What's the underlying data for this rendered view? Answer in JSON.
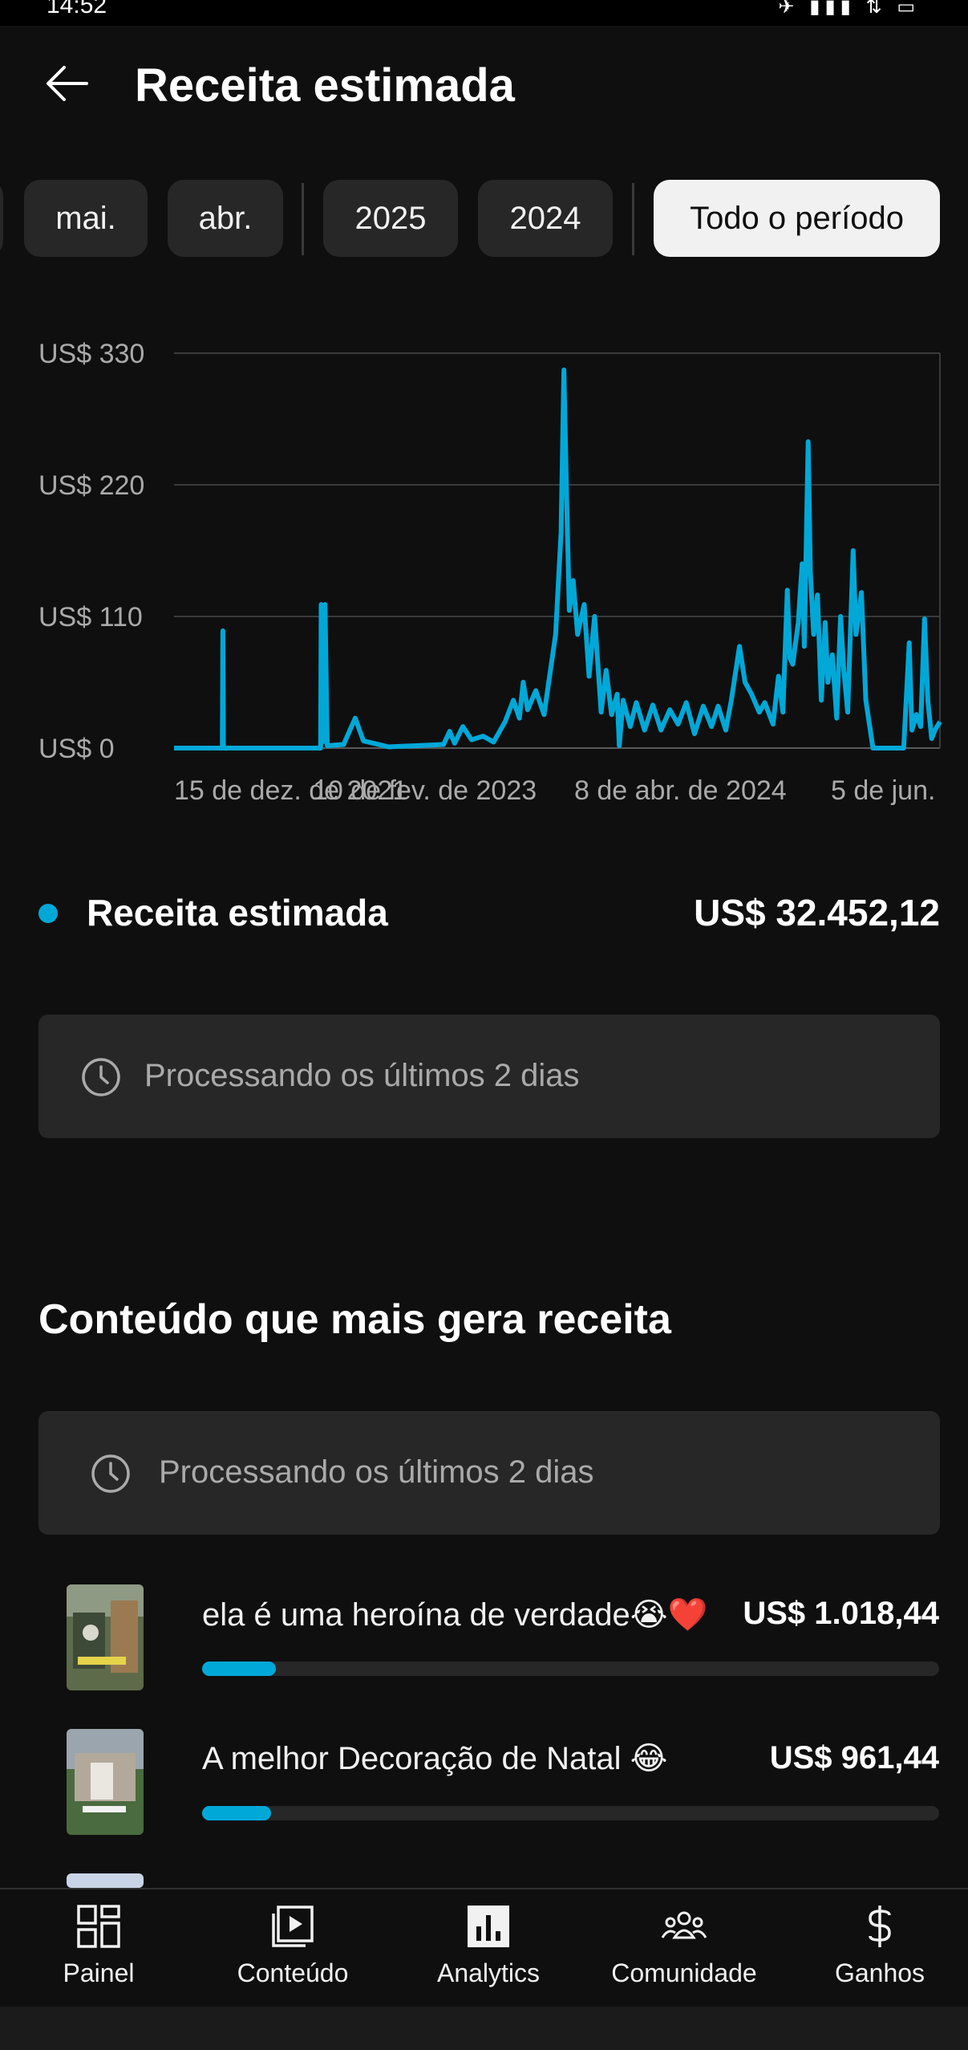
{
  "status_bar": {
    "time": "14:52",
    "icons_text": "✈ ▮▮▮ ⇅ ▭"
  },
  "header": {
    "title": "Receita estimada",
    "back_icon": "arrow-left-icon"
  },
  "filters": {
    "chips": [
      "mai.",
      "abr.",
      "2025",
      "2024",
      "Todo o período"
    ],
    "selected": "Todo o período"
  },
  "colors": {
    "accent": "#00a8d8",
    "background": "#0f0f0f",
    "card": "#272727",
    "muted_text": "#aaaaaa"
  },
  "chart_data": {
    "type": "line",
    "y_ticks": [
      "US$ 330",
      "US$ 220",
      "US$ 110",
      "US$ 0"
    ],
    "ylim": [
      0,
      330
    ],
    "x_tick_labels": [
      "15 de dez. de 2021",
      "10 de fev. de 2023",
      "8 de abr. de 2024",
      "5 de jun."
    ],
    "x_range": [
      "2021-12-15",
      "2025-06-05"
    ],
    "grid": true,
    "series": [
      {
        "name": "Receita estimada",
        "points": [
          [
            "2021-12-15",
            0
          ],
          [
            "2022-03-01",
            0
          ],
          [
            "2022-03-13",
            0
          ],
          [
            "2022-03-14",
            98
          ],
          [
            "2022-03-15",
            0
          ],
          [
            "2022-08-20",
            0
          ],
          [
            "2022-09-08",
            0
          ],
          [
            "2022-09-09",
            120
          ],
          [
            "2022-09-12",
            5
          ],
          [
            "2022-09-16",
            120
          ],
          [
            "2022-09-20",
            2
          ],
          [
            "2022-10-20",
            3
          ],
          [
            "2022-11-10",
            25
          ],
          [
            "2022-11-25",
            6
          ],
          [
            "2023-01-10",
            1
          ],
          [
            "2023-03-01",
            2
          ],
          [
            "2023-04-20",
            3
          ],
          [
            "2023-05-01",
            14
          ],
          [
            "2023-05-10",
            4
          ],
          [
            "2023-05-25",
            18
          ],
          [
            "2023-06-10",
            7
          ],
          [
            "2023-07-01",
            10
          ],
          [
            "2023-07-20",
            5
          ],
          [
            "2023-08-10",
            22
          ],
          [
            "2023-08-25",
            40
          ],
          [
            "2023-09-05",
            25
          ],
          [
            "2023-09-12",
            55
          ],
          [
            "2023-09-20",
            32
          ],
          [
            "2023-10-05",
            48
          ],
          [
            "2023-10-20",
            28
          ],
          [
            "2023-11-10",
            95
          ],
          [
            "2023-11-20",
            180
          ],
          [
            "2023-11-25",
            316
          ],
          [
            "2023-11-30",
            210
          ],
          [
            "2023-12-05",
            115
          ],
          [
            "2023-12-12",
            140
          ],
          [
            "2023-12-20",
            95
          ],
          [
            "2024-01-01",
            120
          ],
          [
            "2024-01-10",
            60
          ],
          [
            "2024-01-20",
            110
          ],
          [
            "2024-02-01",
            30
          ],
          [
            "2024-02-10",
            65
          ],
          [
            "2024-02-20",
            28
          ],
          [
            "2024-03-01",
            45
          ],
          [
            "2024-03-05",
            2
          ],
          [
            "2024-03-12",
            40
          ],
          [
            "2024-03-25",
            18
          ],
          [
            "2024-04-05",
            38
          ],
          [
            "2024-04-20",
            15
          ],
          [
            "2024-05-05",
            36
          ],
          [
            "2024-05-20",
            15
          ],
          [
            "2024-06-05",
            32
          ],
          [
            "2024-06-20",
            20
          ],
          [
            "2024-07-05",
            38
          ],
          [
            "2024-07-20",
            12
          ],
          [
            "2024-08-05",
            35
          ],
          [
            "2024-08-20",
            18
          ],
          [
            "2024-09-01",
            35
          ],
          [
            "2024-09-15",
            15
          ],
          [
            "2024-09-25",
            40
          ],
          [
            "2024-10-10",
            85
          ],
          [
            "2024-10-20",
            55
          ],
          [
            "2024-11-01",
            45
          ],
          [
            "2024-11-15",
            30
          ],
          [
            "2024-11-25",
            38
          ],
          [
            "2024-12-10",
            20
          ],
          [
            "2024-12-20",
            60
          ],
          [
            "2024-12-28",
            30
          ],
          [
            "2025-01-05",
            132
          ],
          [
            "2025-01-10",
            75
          ],
          [
            "2025-01-15",
            70
          ],
          [
            "2025-01-25",
            105
          ],
          [
            "2025-02-01",
            154
          ],
          [
            "2025-02-05",
            85
          ],
          [
            "2025-02-12",
            256
          ],
          [
            "2025-02-16",
            148
          ],
          [
            "2025-02-22",
            95
          ],
          [
            "2025-03-01",
            128
          ],
          [
            "2025-03-08",
            40
          ],
          [
            "2025-03-15",
            105
          ],
          [
            "2025-03-20",
            55
          ],
          [
            "2025-03-28",
            78
          ],
          [
            "2025-04-05",
            25
          ],
          [
            "2025-04-12",
            110
          ],
          [
            "2025-04-18",
            65
          ],
          [
            "2025-04-25",
            30
          ],
          [
            "2025-05-05",
            165
          ],
          [
            "2025-05-10",
            95
          ],
          [
            "2025-05-20",
            130
          ],
          [
            "2025-05-28",
            40
          ],
          [
            "2025-06-10",
            0
          ],
          [
            "2025-07-20",
            0
          ],
          [
            "2025-08-05",
            0
          ],
          [
            "2025-08-15",
            88
          ],
          [
            "2025-08-20",
            15
          ],
          [
            "2025-08-28",
            28
          ],
          [
            "2025-09-05",
            18
          ],
          [
            "2025-09-12",
            108
          ],
          [
            "2025-09-18",
            40
          ],
          [
            "2025-09-25",
            8
          ],
          [
            "2025-10-01",
            15
          ],
          [
            "2025-10-10",
            22
          ]
        ]
      }
    ]
  },
  "summary": {
    "label": "Receita estimada",
    "total": "US$ 32.452,12"
  },
  "processing_notice": "Processando os últimos 2 dias",
  "top_content": {
    "title": "Conteúdo que mais gera receita",
    "notice": "Processando os últimos 2 dias",
    "items": [
      {
        "title": "ela é uma heroína de verdade😭❤️",
        "value": "US$ 1.018,44",
        "share": 0.1
      },
      {
        "title": "A melhor Decoração de Natal 😂",
        "value": "US$ 961,44",
        "share": 0.094
      }
    ]
  },
  "bottom_nav": [
    {
      "label": "Painel",
      "icon": "dashboard-icon"
    },
    {
      "label": "Conteúdo",
      "icon": "content-icon"
    },
    {
      "label": "Analytics",
      "icon": "analytics-icon"
    },
    {
      "label": "Comunidade",
      "icon": "community-icon"
    },
    {
      "label": "Ganhos",
      "icon": "dollar-icon"
    }
  ]
}
